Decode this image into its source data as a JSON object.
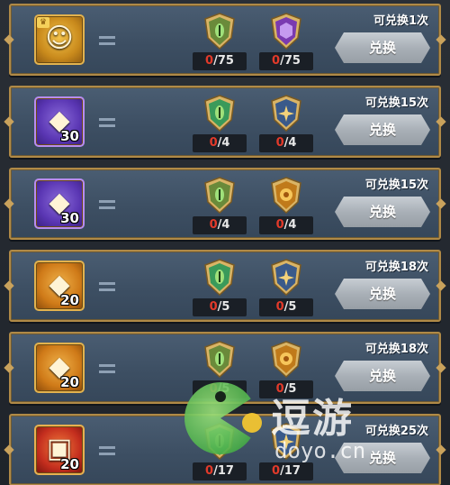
{
  "rows": [
    {
      "item": {
        "type": "hero-portrait",
        "icon": "hero-portrait-icon",
        "glyph": "☺",
        "count": "",
        "color": "gold",
        "crown": "♛"
      },
      "costs": [
        {
          "icon": "green-emblem-icon",
          "have": "0",
          "need": "75",
          "color": "#6a8a3a"
        },
        {
          "icon": "purple-emblem-icon",
          "have": "0",
          "need": "75",
          "color": "#7a3ab0"
        }
      ],
      "times_label": "可兑换1次",
      "button_label": "兑换"
    },
    {
      "item": {
        "type": "silver-crystal",
        "icon": "silver-crystal-icon",
        "glyph": "◆",
        "count": "30",
        "color": "purple"
      },
      "costs": [
        {
          "icon": "green-emblem-icon",
          "have": "0",
          "need": "4",
          "color": "#3a9a5a"
        },
        {
          "icon": "blue-star-emblem-icon",
          "have": "0",
          "need": "4",
          "color": "#3a5a8a"
        }
      ],
      "times_label": "可兑换15次",
      "button_label": "兑换"
    },
    {
      "item": {
        "type": "silver-crystal",
        "icon": "silver-crystal-icon",
        "glyph": "◆",
        "count": "30",
        "color": "purple"
      },
      "costs": [
        {
          "icon": "green-emblem-icon",
          "have": "0",
          "need": "4",
          "color": "#6a8a3a"
        },
        {
          "icon": "orange-emblem-icon",
          "have": "0",
          "need": "4",
          "color": "#c07a1a"
        }
      ],
      "times_label": "可兑换15次",
      "button_label": "兑换"
    },
    {
      "item": {
        "type": "gold-crystal",
        "icon": "gold-crystal-icon",
        "glyph": "◆",
        "count": "20",
        "color": "orange"
      },
      "costs": [
        {
          "icon": "green-emblem-icon",
          "have": "0",
          "need": "5",
          "color": "#3a9a5a"
        },
        {
          "icon": "blue-star-emblem-icon",
          "have": "0",
          "need": "5",
          "color": "#3a5a8a"
        }
      ],
      "times_label": "可兑换18次",
      "button_label": "兑换"
    },
    {
      "item": {
        "type": "gold-crystal",
        "icon": "gold-crystal-icon",
        "glyph": "◆",
        "count": "20",
        "color": "orange"
      },
      "costs": [
        {
          "icon": "green-emblem-icon",
          "have": "0",
          "need": "5",
          "color": "#6a8a3a"
        },
        {
          "icon": "orange-emblem-icon",
          "have": "0",
          "need": "5",
          "color": "#c07a1a"
        }
      ],
      "times_label": "可兑换18次",
      "button_label": "兑换"
    },
    {
      "item": {
        "type": "treasure-chest",
        "icon": "treasure-chest-icon",
        "glyph": "▣",
        "count": "20",
        "color": "red"
      },
      "costs": [
        {
          "icon": "green-emblem-icon",
          "have": "0",
          "need": "17",
          "color": "#3a9a5a"
        },
        {
          "icon": "blue-star-emblem-icon",
          "have": "0",
          "need": "17",
          "color": "#3a5a8a"
        }
      ],
      "times_label": "可兑换25次",
      "button_label": "兑换"
    }
  ],
  "watermark": {
    "cn": "逗游",
    "en": "doyo.cn"
  }
}
